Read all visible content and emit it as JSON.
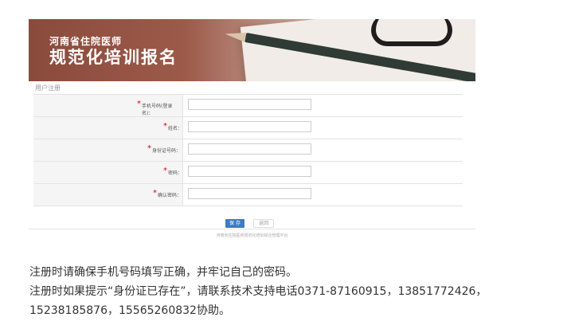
{
  "banner": {
    "line1": "河南省住院医师",
    "line2": "规范化培训报名"
  },
  "section_title": "用户注册",
  "form": {
    "fields": [
      {
        "label": "手机号码(登录名)：",
        "required": true,
        "value": ""
      },
      {
        "label": "姓名：",
        "required": true,
        "value": ""
      },
      {
        "label": "身份证号码：",
        "required": true,
        "value": ""
      },
      {
        "label": "密码：",
        "required": true,
        "value": ""
      },
      {
        "label": "确认密码：",
        "required": true,
        "value": ""
      }
    ],
    "required_mark": "*"
  },
  "buttons": {
    "save": "保 存",
    "back": "返回"
  },
  "footer": "河南省住院医师规范化培训综合管理平台",
  "notes": [
    "注册时请确保手机号码填写正确，并牢记自己的密码。",
    "注册时如果提示“身份证已存在”，请联系技术支持电话0371-87160915，13851772426，",
    "15238185876，15565260832协助。"
  ],
  "colors": {
    "banner": "#8a4a3c",
    "save_button": "#3b7dc4",
    "required_star": "#dd0000"
  }
}
